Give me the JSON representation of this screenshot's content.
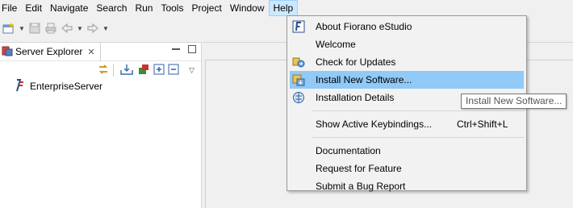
{
  "menubar": {
    "items": [
      "File",
      "Edit",
      "Navigate",
      "Search",
      "Run",
      "Tools",
      "Project",
      "Window",
      "Help"
    ],
    "active": "Help"
  },
  "toolbar": {
    "icons": [
      "new-wizard-icon",
      "save-icon",
      "print-icon",
      "back-icon",
      "forward-icon"
    ]
  },
  "explorer": {
    "title": "Server Explorer",
    "tree": [
      {
        "label": "EnterpriseServer",
        "icon": "fiorano-server-icon"
      }
    ]
  },
  "help_menu": {
    "items": [
      {
        "label": "About Fiorano eStudio",
        "icon": "fiorano-logo-icon"
      },
      {
        "label": "Welcome",
        "icon": ""
      },
      {
        "label": "Check for Updates",
        "icon": "check-updates-icon"
      },
      {
        "label": "Install New Software...",
        "icon": "install-software-icon",
        "highlighted": true
      },
      {
        "label": "Installation Details",
        "icon": "installation-details-icon"
      },
      {
        "label": "Show Active Keybindings...",
        "accelerator": "Ctrl+Shift+L"
      },
      {
        "label": "Documentation"
      },
      {
        "label": "Request for Feature"
      },
      {
        "label": "Submit a Bug Report"
      }
    ]
  },
  "tooltip": {
    "text": "Install New Software..."
  },
  "colors": {
    "menu_highlight": "#91c9f7",
    "menubar_active": "#cce8ff",
    "background": "#f0f0f0"
  }
}
